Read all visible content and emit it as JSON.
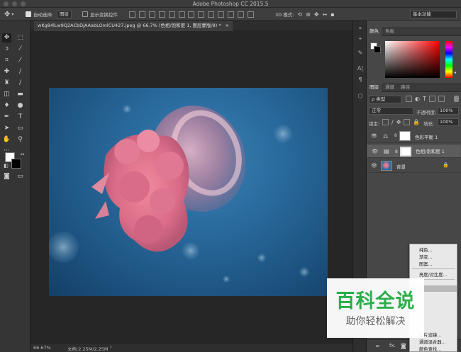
{
  "window": {
    "title": "Adobe Photoshop CC 2015.5"
  },
  "options_bar": {
    "auto_select_label": "自动选择:",
    "auto_select_value": "图层",
    "show_transform_label": "显示变换控件",
    "mode_3d_label": "3D 模式:",
    "workspace_value": "基本功能"
  },
  "document": {
    "tab_title": "wKg84lLw9Q2ACbDjAAabLOmlCU427.jpeg @ 66.7% (色相/饱和度 1, 图层蒙版/8) *",
    "tab_close": "×"
  },
  "status": {
    "zoom": "66.67%",
    "doc_size": "文档:2.25M/2.25M"
  },
  "color_panel": {
    "tabs": [
      "颜色",
      "色板"
    ],
    "accent_red": "#ff0000"
  },
  "layers_panel": {
    "tabs": [
      "图层",
      "通道",
      "路径"
    ],
    "filter_label": "ρ 类型",
    "blend_mode": "正常",
    "opacity_label": "不透明度:",
    "opacity_value": "100%",
    "lock_label": "锁定:",
    "fill_label": "填充:",
    "fill_value": "100%",
    "layers": [
      {
        "name": "色彩平衡 1",
        "type": "adjustment"
      },
      {
        "name": "色相/饱和度 1",
        "type": "adjustment",
        "selected": true
      },
      {
        "name": "背景",
        "type": "image",
        "locked": true
      }
    ],
    "fx_label": "fx."
  },
  "context_menu": {
    "items": [
      "纯色...",
      "渐变...",
      "图案...",
      "亮度/对比度...",
      "照片滤镜...",
      "通道混合器...",
      "颜色查找..."
    ],
    "highlighted_index": 4
  },
  "watermark": {
    "title": "百科全说",
    "subtitle": "助你轻松解决",
    "color": "#2bb24c"
  }
}
